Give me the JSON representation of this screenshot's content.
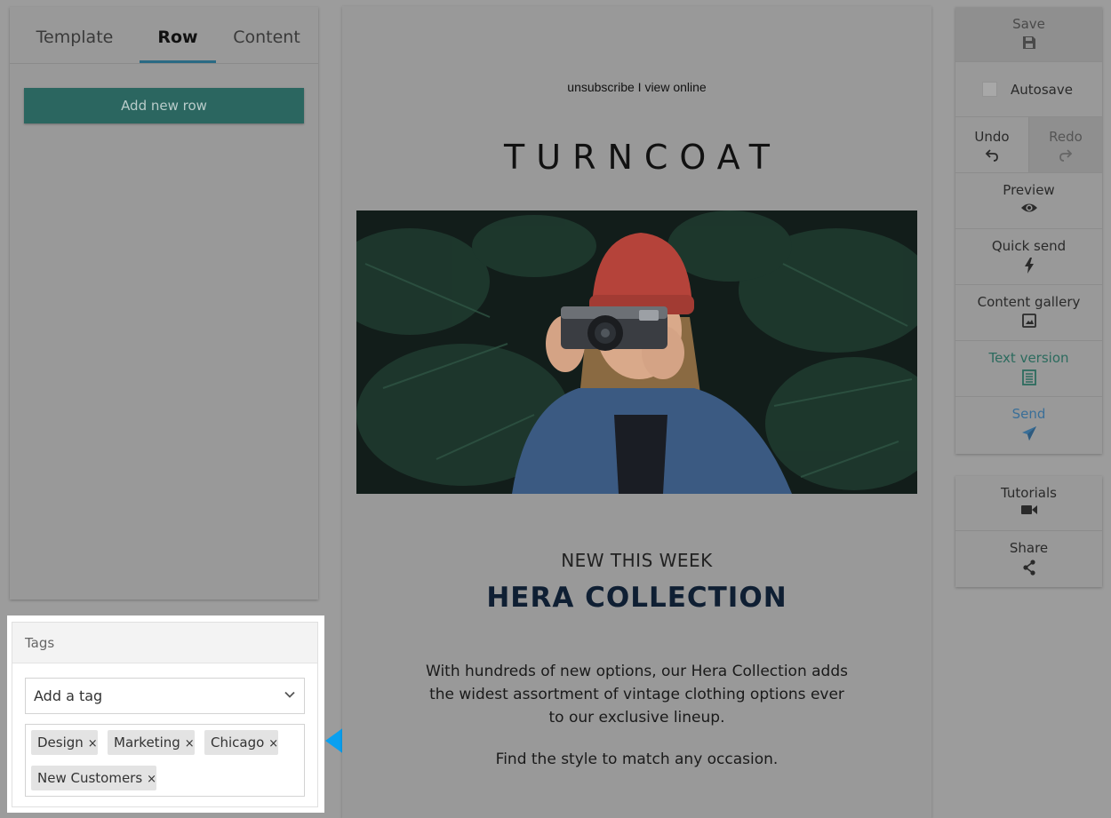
{
  "left_panel": {
    "tabs": [
      {
        "label": "Template",
        "active": false
      },
      {
        "label": "Row",
        "active": true
      },
      {
        "label": "Content",
        "active": false
      }
    ],
    "add_row_label": "Add new row"
  },
  "tags": {
    "title": "Tags",
    "select_placeholder": "Add a tag",
    "items": [
      "Design",
      "Marketing",
      "Chicago",
      "New Customers"
    ],
    "remove_glyph": "×"
  },
  "email": {
    "preheader": "unsubscribe I view online",
    "brand": "TURNCOAT",
    "hero_alt": "Woman in red beanie holding a camera",
    "subhead": "NEW THIS WEEK",
    "headline": "HERA COLLECTION",
    "body": "With hundreds of new options, our Hera Collection adds the widest assortment of vintage clothing options ever to our exclusive lineup.",
    "body2": "Find the style to match any occasion."
  },
  "toolbar": {
    "save": "Save",
    "autosave": "Autosave",
    "undo": "Undo",
    "redo": "Redo",
    "preview": "Preview",
    "quick_send": "Quick send",
    "content_gallery": "Content gallery",
    "text_version": "Text version",
    "send": "Send",
    "tutorials": "Tutorials",
    "share": "Share"
  },
  "colors": {
    "accent_teal": "#2b6660",
    "tab_underline": "#2a6a84",
    "send_blue": "#3a6f98",
    "arrow_blue": "#0aa0f0"
  }
}
